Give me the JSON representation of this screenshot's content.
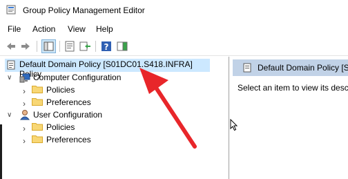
{
  "window": {
    "title": "Group Policy Management Editor"
  },
  "menu": {
    "items": [
      "File",
      "Action",
      "View",
      "Help"
    ]
  },
  "toolbar": {
    "buttons": [
      "back-icon",
      "forward-icon",
      "show-hide-console-tree-icon",
      "properties-icon",
      "export-list-icon",
      "help-icon",
      "show-hide-action-pane-icon"
    ]
  },
  "tree": {
    "root": "Default Domain Policy [S01DC01.S418.INFRA] Policy",
    "computer_config": {
      "label": "Computer Configuration",
      "children": [
        "Policies",
        "Preferences"
      ]
    },
    "user_config": {
      "label": "User Configuration",
      "children": [
        "Policies",
        "Preferences"
      ]
    }
  },
  "details": {
    "header": "Default Domain Policy [S",
    "text": "Select an item to view its descr"
  },
  "colors": {
    "selection": "#cce8ff",
    "annotation_arrow": "#e8262a",
    "details_header": "#c1d2e7"
  }
}
